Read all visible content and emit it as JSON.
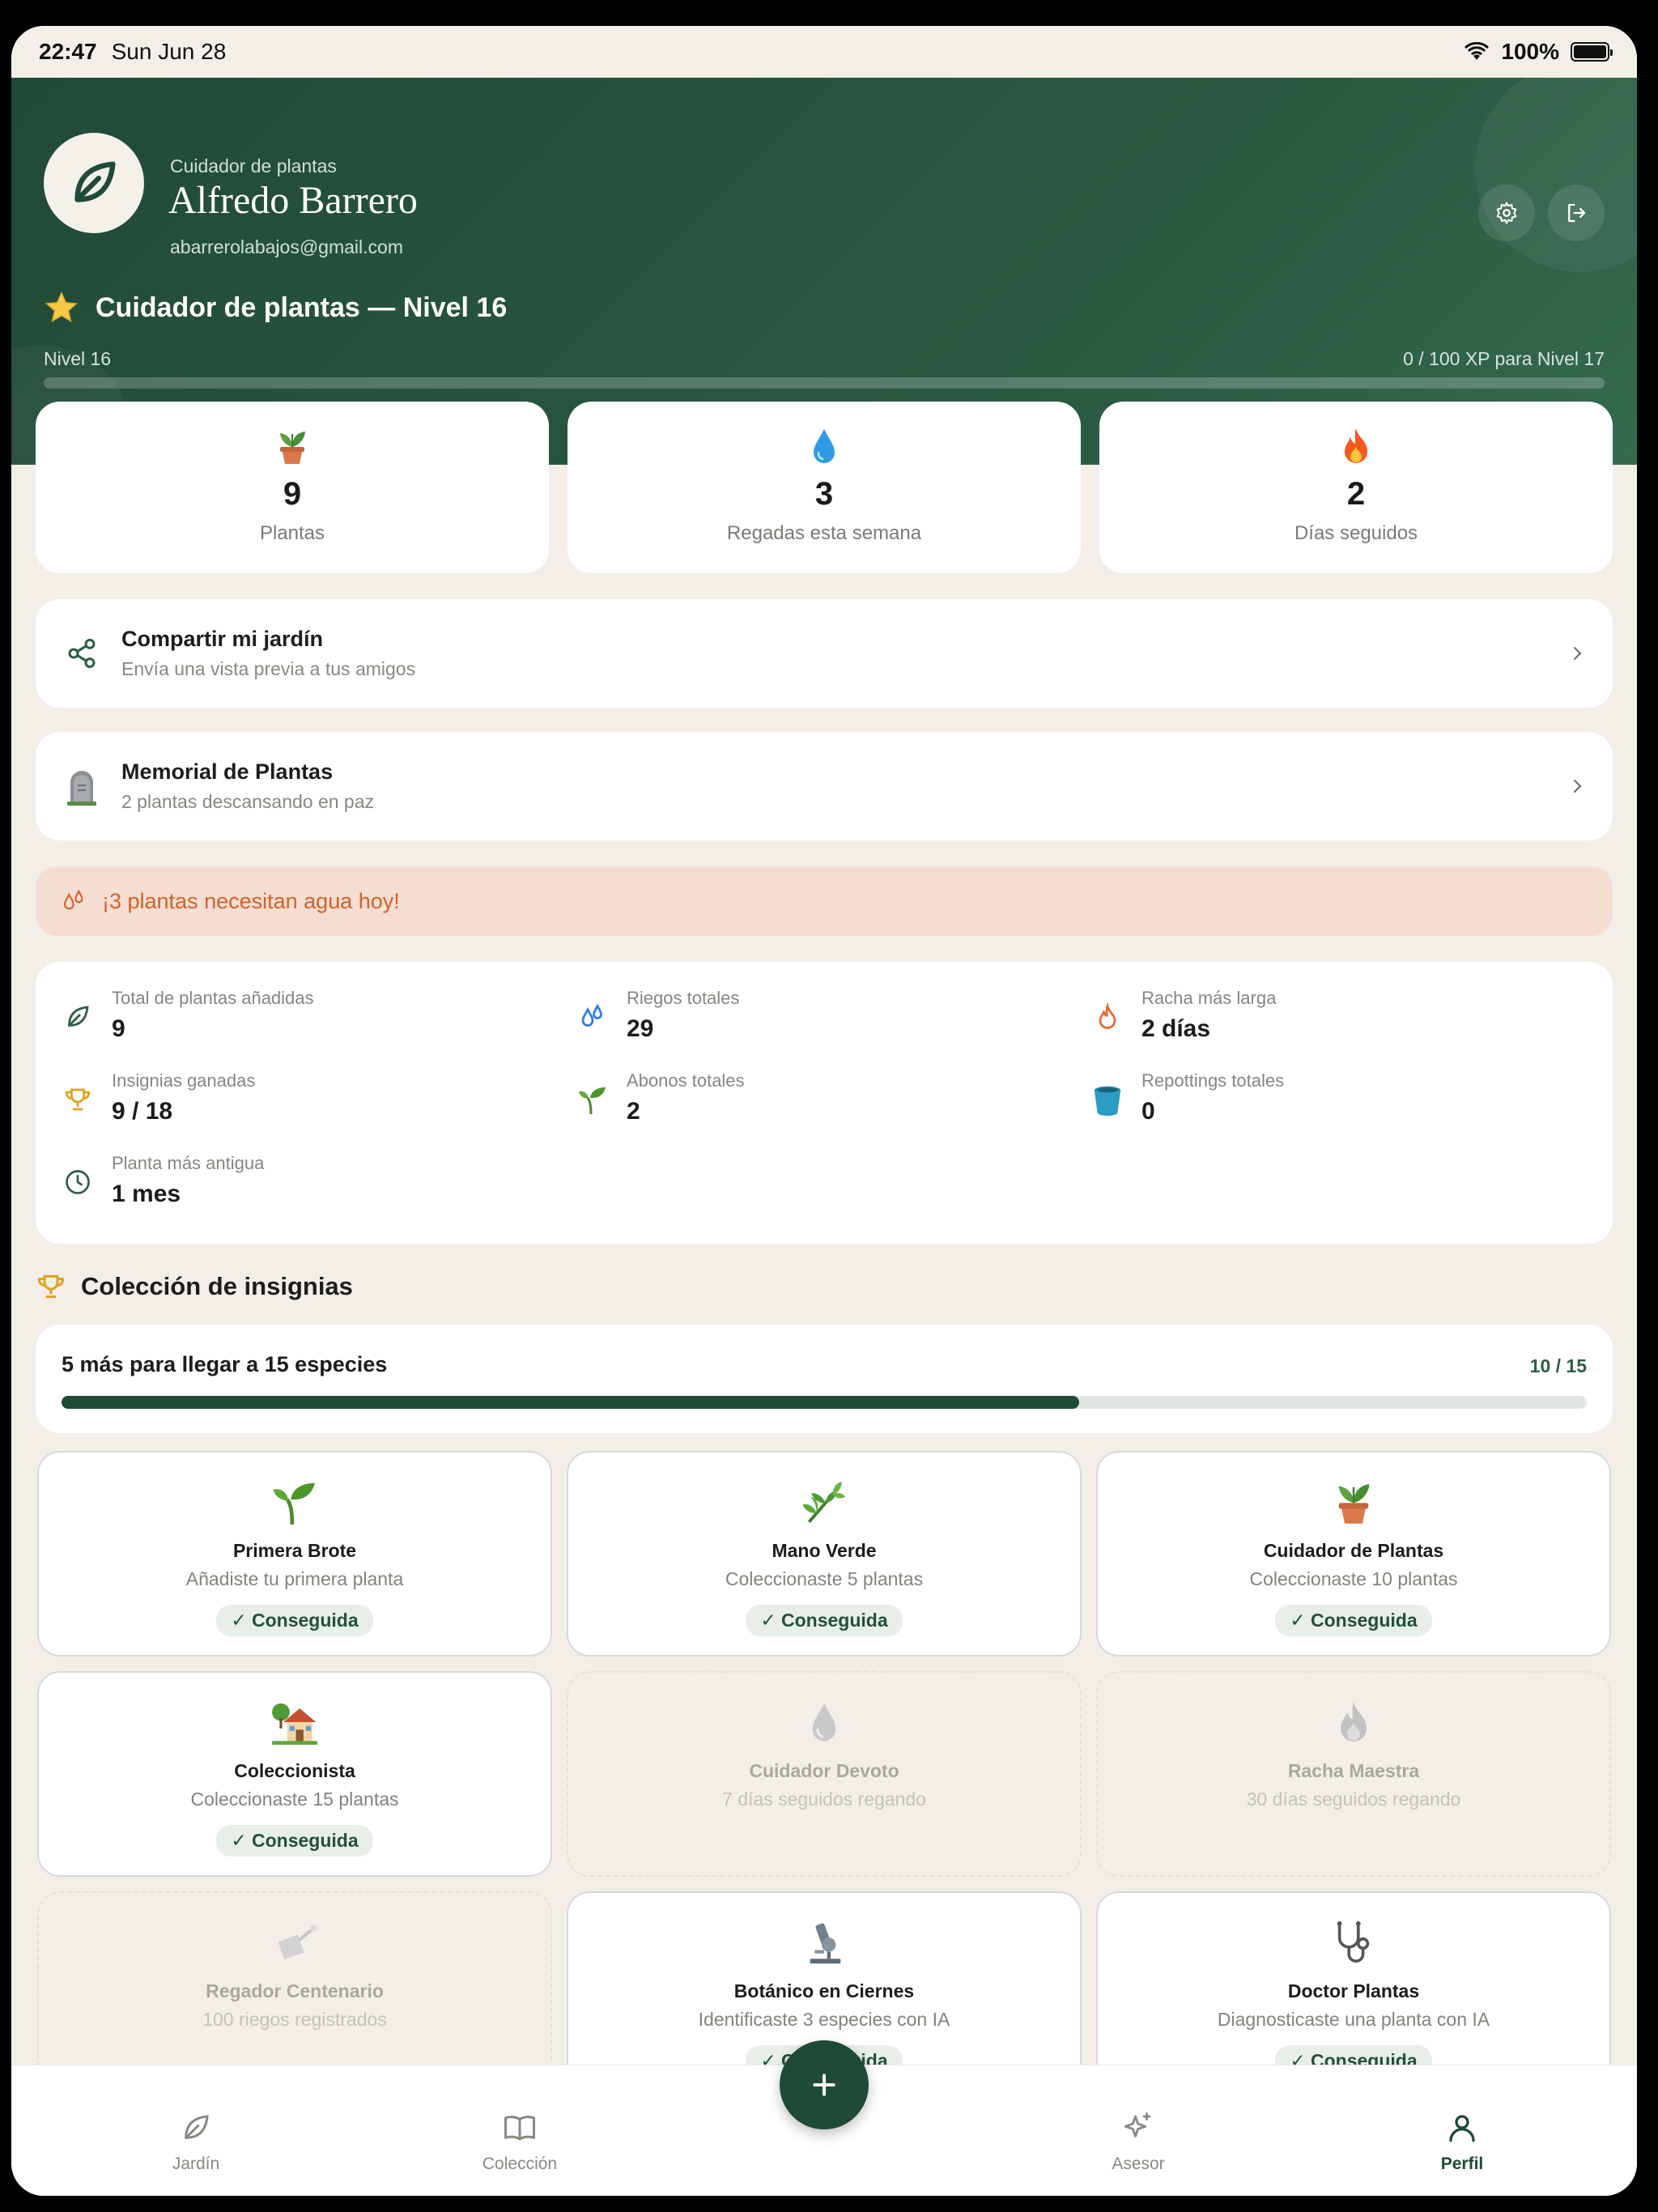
{
  "status_bar": {
    "time": "22:47",
    "date": "Sun Jun 28",
    "battery": "100%"
  },
  "profile": {
    "role": "Cuidador de plantas",
    "name": "Alfredo Barrero",
    "email": "abarrerolabajos@gmail.com",
    "level_title": "Cuidador de plantas — Nivel 16",
    "level_label": "Nivel 16",
    "xp_label": "0 / 100 XP para Nivel 17",
    "xp_progress": 0
  },
  "stats_cards": [
    {
      "icon": "potted-plant-icon",
      "value": "9",
      "label": "Plantas"
    },
    {
      "icon": "water-drop-icon",
      "value": "3",
      "label": "Regadas esta semana"
    },
    {
      "icon": "fire-icon",
      "value": "2",
      "label": "Días seguidos"
    }
  ],
  "share": {
    "title": "Compartir mi jardín",
    "subtitle": "Envía una vista previa a tus amigos"
  },
  "memorial": {
    "title": "Memorial de Plantas",
    "subtitle": "2 plantas descansando en paz"
  },
  "alert": {
    "text": "¡3 plantas necesitan agua hoy!"
  },
  "summary": [
    {
      "label": "Total de plantas añadidas",
      "value": "9"
    },
    {
      "label": "Riegos totales",
      "value": "29"
    },
    {
      "label": "Racha más larga",
      "value": "2 días"
    },
    {
      "label": "Insignias ganadas",
      "value": "9 / 18"
    },
    {
      "label": "Abonos totales",
      "value": "2"
    },
    {
      "label": "Repottings totales",
      "value": "0"
    },
    {
      "label": "Planta más antigua",
      "value": "1 mes"
    }
  ],
  "badges_section": {
    "title": "Colección de insignias",
    "progress_text": "5 más para llegar a 15 especies",
    "progress_count": "10 / 15",
    "progress_fraction": 0.667
  },
  "badges": [
    {
      "title": "Primera Brote",
      "desc": "Añadiste tu primera planta",
      "status": "✓ Conseguida"
    },
    {
      "title": "Mano Verde",
      "desc": "Coleccionaste 5 plantas",
      "status": "✓ Conseguida"
    },
    {
      "title": "Cuidador de Plantas",
      "desc": "Coleccionaste 10 plantas",
      "status": "✓ Conseguida"
    },
    {
      "title": "Coleccionista",
      "desc": "Coleccionaste 15 plantas",
      "status": "✓ Conseguida"
    },
    {
      "title": "Cuidador Devoto",
      "desc": "7 días seguidos regando",
      "status": ""
    },
    {
      "title": "Racha Maestra",
      "desc": "30 días seguidos regando",
      "status": ""
    },
    {
      "title": "Regador Centenario",
      "desc": "100 riegos registrados",
      "status": ""
    },
    {
      "title": "Botánico en Ciernes",
      "desc": "Identificaste 3 especies con IA",
      "status": "✓ Conseguida"
    },
    {
      "title": "Doctor Plantas",
      "desc": "Diagnosticaste una planta con IA",
      "status": "✓ Conseguida"
    }
  ],
  "tabs": {
    "garden": "Jardín",
    "collection": "Colección",
    "advisor": "Asesor",
    "profile": "Perfil"
  },
  "colors": {
    "header": "#214a37",
    "accent": "#1f4a36",
    "alert_bg": "#f6ddd2",
    "alert_text": "#d2622a",
    "background": "#f3efe8"
  }
}
